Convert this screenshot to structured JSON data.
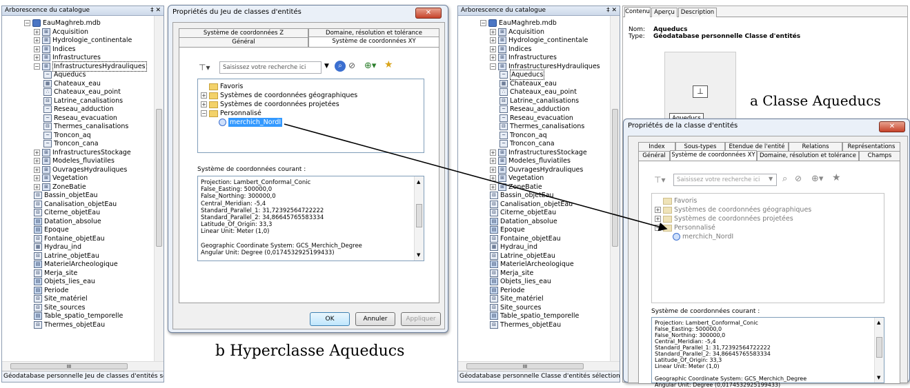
{
  "catalog_pane_title": "Arborescence du catalogue",
  "pin_glyph": "‡ ✕",
  "catalog_tree": [
    {
      "label": "EauMaghreb.mdb",
      "level": 0,
      "exp": "−",
      "icon": "gdb"
    },
    {
      "label": "Acquisition",
      "level": 1,
      "exp": "+",
      "icon": "fd"
    },
    {
      "label": "Hydrologie_continentale",
      "level": 1,
      "exp": "+",
      "icon": "fd"
    },
    {
      "label": "Indices",
      "level": 1,
      "exp": "+",
      "icon": "fd"
    },
    {
      "label": "Infrastructures",
      "level": 1,
      "exp": "+",
      "icon": "fd"
    },
    {
      "label": "InfrastructuresHydrauliques",
      "level": 1,
      "exp": "−",
      "icon": "fd"
    },
    {
      "label": "Aqueducs",
      "level": 2,
      "exp": "",
      "icon": "line"
    },
    {
      "label": "Chateaux_eau",
      "level": 2,
      "exp": "",
      "icon": "raster"
    },
    {
      "label": "Chateaux_eau_point",
      "level": 2,
      "exp": "",
      "icon": "point"
    },
    {
      "label": "Latrine_canalisations",
      "level": 2,
      "exp": "",
      "icon": "rel"
    },
    {
      "label": "Reseau_adduction",
      "level": 2,
      "exp": "",
      "icon": "line"
    },
    {
      "label": "Reseau_evacuation",
      "level": 2,
      "exp": "",
      "icon": "line"
    },
    {
      "label": "Thermes_canalisations",
      "level": 2,
      "exp": "",
      "icon": "rel"
    },
    {
      "label": "Troncon_aq",
      "level": 2,
      "exp": "",
      "icon": "line"
    },
    {
      "label": "Troncon_cana",
      "level": 2,
      "exp": "",
      "icon": "line"
    },
    {
      "label": "InfrastructuresStockage",
      "level": 1,
      "exp": "+",
      "icon": "fd"
    },
    {
      "label": "Modeles_fluviatiles",
      "level": 1,
      "exp": "+",
      "icon": "fd"
    },
    {
      "label": "OuvragesHydrauliques",
      "level": 1,
      "exp": "+",
      "icon": "fd"
    },
    {
      "label": "Vegetation",
      "level": 1,
      "exp": "+",
      "icon": "fd"
    },
    {
      "label": "ZoneBatie",
      "level": 1,
      "exp": "+",
      "icon": "fd"
    },
    {
      "label": "Bassin_objetEau",
      "level": 1,
      "exp": "",
      "icon": "rel"
    },
    {
      "label": "Canalisation_objetEau",
      "level": 1,
      "exp": "",
      "icon": "rel"
    },
    {
      "label": "Citerne_objetEau",
      "level": 1,
      "exp": "",
      "icon": "rel"
    },
    {
      "label": "Datation_absolue",
      "level": 1,
      "exp": "",
      "icon": "tbl"
    },
    {
      "label": "Epoque",
      "level": 1,
      "exp": "",
      "icon": "tbl"
    },
    {
      "label": "Fontaine_objetEau",
      "level": 1,
      "exp": "",
      "icon": "rel"
    },
    {
      "label": "Hydrau_ind",
      "level": 1,
      "exp": "",
      "icon": "raster"
    },
    {
      "label": "Latrine_objetEau",
      "level": 1,
      "exp": "",
      "icon": "rel"
    },
    {
      "label": "MaterielArcheologique",
      "level": 1,
      "exp": "",
      "icon": "tbl"
    },
    {
      "label": "Merja_site",
      "level": 1,
      "exp": "",
      "icon": "rel"
    },
    {
      "label": "Objets_lies_eau",
      "level": 1,
      "exp": "",
      "icon": "tbl"
    },
    {
      "label": "Periode",
      "level": 1,
      "exp": "",
      "icon": "tbl"
    },
    {
      "label": "Site_matériel",
      "level": 1,
      "exp": "",
      "icon": "rel"
    },
    {
      "label": "Site_sources",
      "level": 1,
      "exp": "",
      "icon": "rel"
    },
    {
      "label": "Table_spatio_temporelle",
      "level": 1,
      "exp": "",
      "icon": "tbl"
    },
    {
      "label": "Thermes_objetEau",
      "level": 1,
      "exp": "",
      "icon": "rel"
    }
  ],
  "hscroll_glyph": "III",
  "status_left": "Géodatabase personnelle Jeu de classes d'entités sélectionné(e)",
  "status_right": "Géodatabase personnelle Classe d'entités sélectionné(e)",
  "dialog_b": {
    "title": "Propriétés du Jeu de classes d'entités",
    "tabs_back": [
      "Système de coordonnées Z",
      "Domaine, résolution et tolérance"
    ],
    "tabs_front": [
      "Général",
      "Système de coordonnées XY"
    ],
    "search_placeholder": "Saisissez votre recherche ici",
    "ok": "OK",
    "cancel": "Annuler",
    "apply": "Appliquer"
  },
  "coord_tree": [
    {
      "label": "Favoris",
      "exp": ""
    },
    {
      "label": "Systèmes de coordonnées géographiques",
      "exp": "+"
    },
    {
      "label": "Systèmes de coordonnées projetées",
      "exp": "+"
    },
    {
      "label": "Personnalisé",
      "exp": "−"
    },
    {
      "label": "merchich_NordI",
      "exp": ""
    }
  ],
  "current_cs_label": "Système de coordonnées courant :",
  "projection_lines": [
    "Projection: Lambert_Conformal_Conic",
    "False_Easting: 500000,0",
    "False_Northing: 300000,0",
    "Central_Meridian: -5,4",
    "Standard_Parallel_1: 31,72392564722222",
    "Standard_Parallel_2: 34,86645765583334",
    "Latitude_Of_Origin: 33,3",
    "Linear Unit: Meter (1,0)",
    "",
    "Geographic Coordinate System: GCS_Merchich_Degree",
    "Angular Unit: Degree (0,0174532925199433)"
  ],
  "caption_b": "b Hyperclasse Aqueducs",
  "caption_a": "a Classe Aqueducs",
  "content_tabs": [
    "Contenu",
    "Aperçu",
    "Description"
  ],
  "name_label": "Nom:",
  "name_value": "Aqueducs",
  "type_label": "Type:",
  "type_value": "Géodatabase personnelle Classe d'entités",
  "thumb_label": "Aqueducs",
  "dialog_a": {
    "title": "Propriétés de la classe d'entités",
    "tabs_back": [
      "Index",
      "Sous-types",
      "Etendue de l'entité",
      "Relations",
      "Représentations"
    ],
    "tabs_front": [
      "Général",
      "Système de coordonnées XY",
      "Domaine, résolution et tolérance",
      "Champs"
    ]
  }
}
